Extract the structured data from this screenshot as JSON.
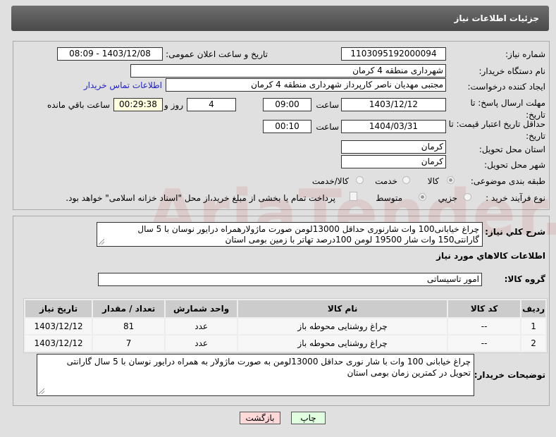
{
  "header": {
    "title": "جزئیات اطلاعات نیاز"
  },
  "form": {
    "need_number_label": "شماره نیاز:",
    "need_number": "1103095192000094",
    "announce_label": "تاریخ و ساعت اعلان عمومی:",
    "announce_value": "1403/12/08 - 08:09",
    "buyer_label": "نام دستگاه خریدار:",
    "buyer": "شهرداری منطقه 4 کرمان",
    "creator_label": "ایجاد کننده درخواست:",
    "creator": "مجتبی مهدیان ناصر کارپرداز شهرداری منطقه 4 کرمان",
    "contact_link": "اطلاعات تماس خریدار",
    "deadline_label": "مهلت ارسال پاسخ: تا تاریخ:",
    "deadline_date": "1403/12/12",
    "time_label": "ساعت",
    "deadline_time": "09:00",
    "days": "4",
    "days_label": "روز و",
    "remaining": "00:29:38",
    "remaining_label": "ساعت باقي مانده",
    "validity_label": "حداقل تاریخ اعتبار قیمت: تا تاریخ:",
    "validity_date": "1404/03/31",
    "validity_time": "00:10",
    "province_label": "استان محل تحویل:",
    "province": "کرمان",
    "city_label": "شهر محل تحویل:",
    "city": "کرمان",
    "category_label": "طبقه بندی موضوعی:",
    "category_options": [
      "کالا",
      "خدمت",
      "کالا/خدمت"
    ],
    "process_label": "نوع فرآیند خرید :",
    "process_options": [
      "جزیي",
      "متوسط"
    ],
    "payment_note": "پرداخت تمام یا بخشی از مبلغ خرید،از محل \"اسناد خزانه اسلامی\" خواهد بود."
  },
  "details": {
    "summary_label": "شرح کلي نیاز:",
    "summary": "چراغ خیابانی100 وات شارنوری حداقل 13000لومن صورت ماژولارهمراه درایور نوسان با 5 سال گارانتی150 وات شار 19500 لومن 100درصد تهاتر با زمین  بومی استان",
    "goods_title": "اطلاعات کالاهاي مورد نیاز",
    "group_label": "گروه کالا:",
    "group": "امور تاسیساتی",
    "table": {
      "headers": [
        "ردیف",
        "کد کالا",
        "نام کالا",
        "واحد شمارش",
        "تعداد / مقدار",
        "تاریخ نیاز"
      ],
      "rows": [
        [
          "1",
          "--",
          "چراغ روشنایی محوطه باز",
          "عدد",
          "81",
          "1403/12/12"
        ],
        [
          "2",
          "--",
          "چراغ روشنایی محوطه باز",
          "عدد",
          "7",
          "1403/12/12"
        ]
      ]
    },
    "notes_label": "توضیحات خریدار:",
    "notes_line1": "چراغ خیابانی 100 وات  با شار نوری حداقل 13000لومن به صورت ماژولار به همراه درایور نوسان با 5 سال گارانتی",
    "notes_line2": "تحویل در کمترین زمان بومی استان"
  },
  "buttons": {
    "back": "بازگشت",
    "print": "چاپ"
  },
  "watermark": "AriaTender.net"
}
